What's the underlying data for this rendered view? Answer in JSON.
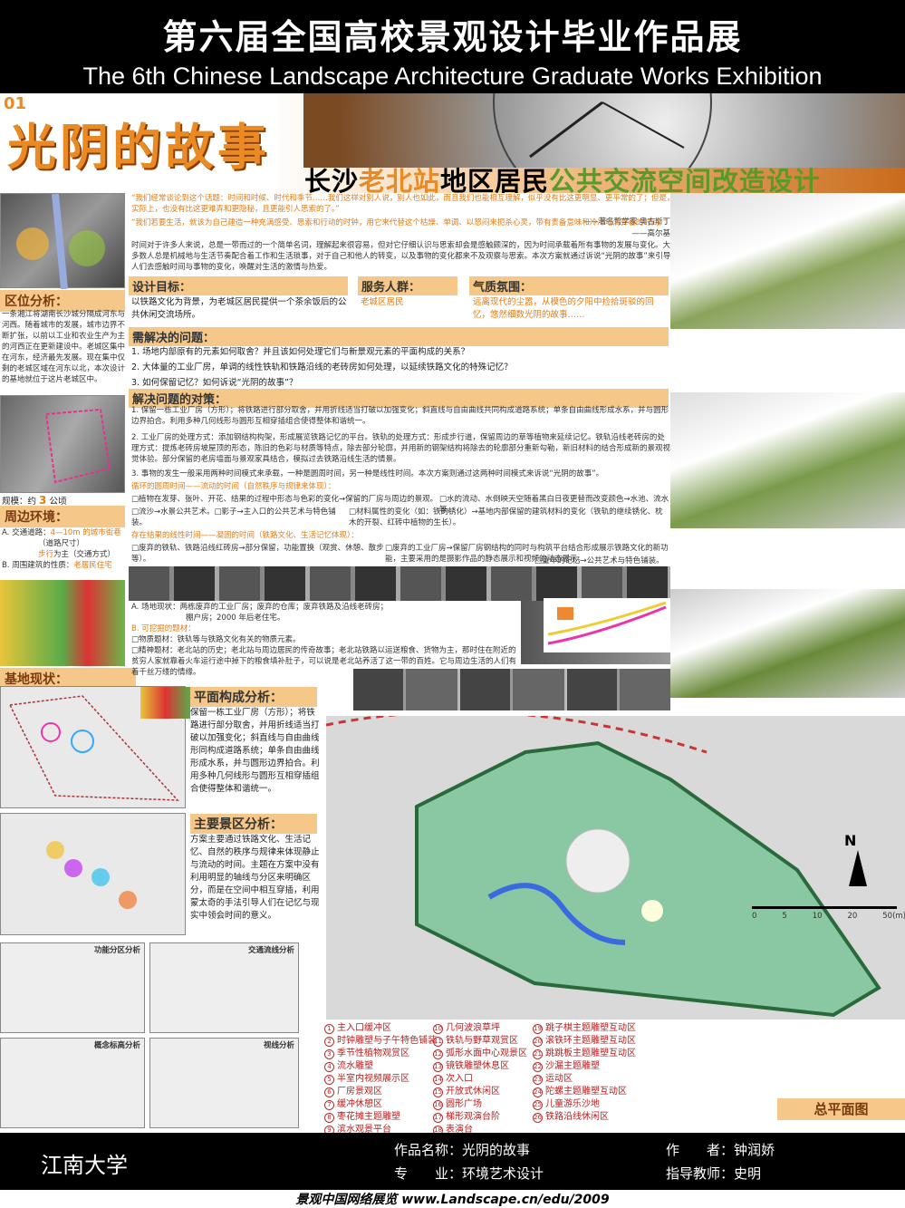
{
  "header": {
    "title_cn": "第六届全国高校景观设计毕业作品展",
    "title_en": "The 6th Chinese Landscape Architecture Graduate Works Exhibition"
  },
  "banner": {
    "number": "01",
    "title": "光阴的故事",
    "subtitle_a": "长沙",
    "subtitle_b": "老北站",
    "subtitle_c": "地区居民",
    "subtitle_d": "公共交流空间改造设计"
  },
  "quotes": {
    "q1": "“我们经常谈论到这个话题：时间和时候、时代和季节……我们这样对别人说，别人也如此，而且我们也能相互理解，似乎没有比这更明显、更平常的了；但是，实际上，也没有比这更难弄和更隐秘，且更能引人思索的了。”",
    "q1_author": "——著名哲学家 奥古斯丁",
    "q2": "“我们若要生活，就该为自己建造一种充满感受、思索和行动的时钟，用它来代替这个枯燥、单调、以怒闷来扼杀心灵，带有责备意味和冷冷地清算着的时间。”",
    "q2_author": "——高尔基",
    "p1": "时间对于许多人来说，总是一带而过的一个简单名词，理解起来很容易，但对它仔细认识与思索却会是感触颇深的，因为时间承载着所有事物的发展与变化。大多数人总是机械地与生活节奏配合着工作和生活琐事，对于自己和他人的转变，以及事物的变化都来不及观察与思索。本次方案就通过诉说“光阴的故事”来引导人们去感触时间与事物的变化，唤醒对生活的激情与热爱。"
  },
  "left": {
    "region_label": "区位分析：",
    "region_text": "一条湘江将湖南长沙城分隔成河东与河西。随着城市的发展，城市边界不断扩张，以前以工业和农业生产为主的河西正在更新建设中。老城区集中在河东，经济最先发展。现在集中仅剩的老城区域在河东以北，本次设计的基地就位于这片老城区中。",
    "scale_label": "规模：约",
    "scale_value": "3",
    "scale_unit": "公顷",
    "env_label": "周边环境：",
    "env_a": "A. 交通道路：",
    "env_a_val": "4—10m 的城市街巷",
    "env_a_sub": "（道路尺寸）",
    "env_a_walk": "步行",
    "env_a_walk2": "为主（交通方式）",
    "env_b": "B. 周围建筑的性质：",
    "env_b_val": "老居民住宅",
    "site_label": "基地现状："
  },
  "goals": {
    "goal_label": "设计目标：",
    "goal_text": "以铁路文化为背景，为老城区居民提供一个茶余饭后的公共休闲交流场所。",
    "people_label": "服务人群：",
    "people_text": "老城区居民",
    "mood_label": "气质氛围：",
    "mood_text": "远离现代的尘嚣，从模色的夕阳中捡拾斑驳的回忆，悠然细数光阴的故事……"
  },
  "problems": {
    "label": "需解决的问题：",
    "p1": "1. 场地内部原有的元素如何取舍？并且该如何处理它们与新景观元素的平面构成的关系？",
    "p2": "2. 大体量的工业厂房，单调的线性铁轨和铁路沿线的老砖房如何处理，以延续铁路文化的特殊记忆？",
    "p3": "3. 如何保留记忆？如何诉说“光阴的故事”？"
  },
  "solutions": {
    "label": "解决问题的对策：",
    "s1": "1. 保留一栋工业厂房（方形）；将铁路进行部分取舍，并用折线适当打破以加强变化；斜直线与自由曲线共同构成道路系统；单条自由曲线形成水系，并与圆形边界拍合。利用多种几何线形与圆形互相穿插组合使得整体和谐统一。",
    "s2": "2. 工业厂房的处理方式：添加钢结构构架，形成展览铁路记忆的平台。铁轨的处理方式：形成步行道，保留周边的草等植物来延续记忆。铁轨沿线老砖房的处理方式：提炼老砖房坡屋顶的形态，陈旧的色彩与材质等特点，除去部分轮廓，并用新的钢架结构将除去的轮廓部分重新勾勒，新旧材料的结合形成新的景观视觉体验。部分保留的老房墙面与景观家具结合，模拟过去铁路沿线生活的情景。",
    "s3": "3. 事物的发生一般采用两种时间模式来承载，一种是圆周时间，另一种是线性时间。本次方案则通过这两种时间模式来诉说“光阴的故事”。",
    "circ_label": "循环的圆周时间——流动的时间（自然秩序与规律来体现）：",
    "circ1": "□植物在发芽、张叶、开花、结果的过程中形态与色彩的变化→保留的厂房与周边的景观。",
    "circ2": "□水的流动、水倒映天空随着黑白日夜更替而改变颜色→水池、流水等。",
    "circ3": "□流沙→水景公共艺术。□影子→主入口的公共艺术与特色铺装。",
    "circ4": "□材料属性的变化（如：铁的锈化）→基地内部保留的建筑材料的变化（铁轨的继续锈化、枕木的开裂、红砖中植物的生长）。",
    "lin_label": "存在结果的线性时间——凝固的时间（铁路文化、生活记忆体现）：",
    "lin1": "□废弃的铁轨、铁路沿线红砖房→部分保留，功能置换（观赏、休憩、散步等）。",
    "lin2": "□废弃的工业厂房→保留厂房钢结构的同时与构筑平台结合形成展示铁路文化的新功能，主要采用的是摄影作品的静态展示和视频的动态展示。",
    "lin3": "□童年的记忆→公共艺术与特色铺装。"
  },
  "site": {
    "a": "A. 场地现状：两栋废弃的工业厂房；废弃的仓库；废弃铁路及沿线老砖房；",
    "a2": "棚户房；2000 年后老住宅。",
    "b": "B. 可挖掘的题材：",
    "b1": "□物质题材：铁轨等与铁路文化有关的物质元素。",
    "b2": "□精神题材：老北站的历史；老北站与周边居民的传奇故事；老北站铁路以运送粮食、货物为主，那时住在附近的贫穷人家就靠着火车运行途中掉下的粮食填补肚子，可以说是老北站养活了这一带的百姓。它与周边生活的人们有着千丝万缕的情缘。"
  },
  "plan": {
    "comp_label": "平面构成分析：",
    "comp_text": "保留一栋工业厂房（方形）；将铁路进行部分取舍，并用折线适当打破以加强变化；斜直线与自由曲线形同构成道路系统；单条自由曲线形成水系，并与圆形边界拍合。利用多种几何线形与圆形互相穿插组合使得整体和谐统一。",
    "scene_label": "主要景区分析：",
    "scene_text": "方案主要通过铁路文化、生活记忆、自然的秩序与规律来体现静止与流动的时间。主题在方案中没有利用明显的轴线与分区来明确区分，而是在空间中相互穿插，利用蒙太奇的手法引导人们在记忆与现实中领会时间的意义。",
    "func_label": "功能分区分析",
    "traffic_label": "交通流线分析",
    "concept_label": "概念标高分析",
    "view_label": "视线分析",
    "north": "N",
    "scale": [
      "0",
      "5",
      "10",
      "20",
      "50(m)"
    ],
    "master_label": "总平面图"
  },
  "legend": [
    [
      "1",
      "主入口缓冲区"
    ],
    [
      "2",
      "时钟雕塑与子午特色铺装"
    ],
    [
      "3",
      "季节性植物观赏区"
    ],
    [
      "4",
      "流水雕塑"
    ],
    [
      "5",
      "半室内视频展示区"
    ],
    [
      "6",
      "厂房景观区"
    ],
    [
      "7",
      "缓冲休憩区"
    ],
    [
      "8",
      "枣花摊主题雕塑"
    ],
    [
      "9",
      "滨水观景平台"
    ],
    [
      "10",
      "几何波浪草坪"
    ],
    [
      "11",
      "铁轨与野草观赏区"
    ],
    [
      "12",
      "弧形水面中心观景区"
    ],
    [
      "13",
      "镜铁雕塑休息区"
    ],
    [
      "14",
      "次入口"
    ],
    [
      "15",
      "开放式休闲区"
    ],
    [
      "16",
      "圆形广场"
    ],
    [
      "17",
      "梯形观演台阶"
    ],
    [
      "18",
      "表演台"
    ],
    [
      "19",
      "跳子棋主题雕塑互动区"
    ],
    [
      "20",
      "滚铁环主题雕塑互动区"
    ],
    [
      "21",
      "跳跳板主题雕塑互动区"
    ],
    [
      "22",
      "沙漏主题雕塑"
    ],
    [
      "23",
      "运动区"
    ],
    [
      "24",
      "陀螺主题雕塑互动区"
    ],
    [
      "25",
      "儿童游乐沙地"
    ],
    [
      "26",
      "铁路沿线休闲区"
    ]
  ],
  "footer": {
    "school": "江南大学",
    "work_label": "作品名称：",
    "work_name": "光阴的故事",
    "major_label": "专　　业：",
    "major_name": "环境艺术设计",
    "author_label": "作　　者：",
    "author_name": "钟润娇",
    "teacher_label": "指导教师：",
    "teacher_name": "史明",
    "site": "景观中国网络展览 www.Landscape.cn/edu/2009"
  }
}
